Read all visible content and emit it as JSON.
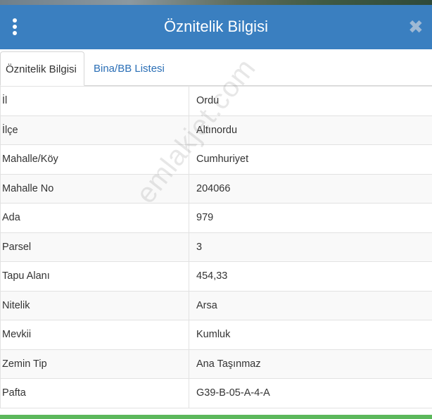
{
  "header": {
    "title": "Öznitelik Bilgisi",
    "menu_icon": "kebab-menu-icon",
    "close_icon": "close-icon",
    "close_glyph": "✖",
    "background": "#3a7fc0"
  },
  "tabs": [
    {
      "label": "Öznitelik Bilgisi",
      "active": true
    },
    {
      "label": "Bina/BB Listesi",
      "active": false
    }
  ],
  "rows": [
    {
      "key": "İl",
      "value": "Ordu"
    },
    {
      "key": "İlçe",
      "value": "Altınordu"
    },
    {
      "key": "Mahalle/Köy",
      "value": "Cumhuriyet"
    },
    {
      "key": "Mahalle No",
      "value": "204066"
    },
    {
      "key": "Ada",
      "value": "979"
    },
    {
      "key": "Parsel",
      "value": "3"
    },
    {
      "key": "Tapu Alanı",
      "value": "454,33"
    },
    {
      "key": "Nitelik",
      "value": "Arsa"
    },
    {
      "key": "Mevkii",
      "value": "Kumluk"
    },
    {
      "key": "Zemin Tip",
      "value": "Ana Taşınmaz"
    },
    {
      "key": "Pafta",
      "value": "G39-B-05-A-4-A"
    }
  ],
  "watermark": "emlakjet.com",
  "colors": {
    "accent": "#3a7fc0",
    "tab_link": "#2b6fb6",
    "bottom_bar": "#5cb85c"
  }
}
